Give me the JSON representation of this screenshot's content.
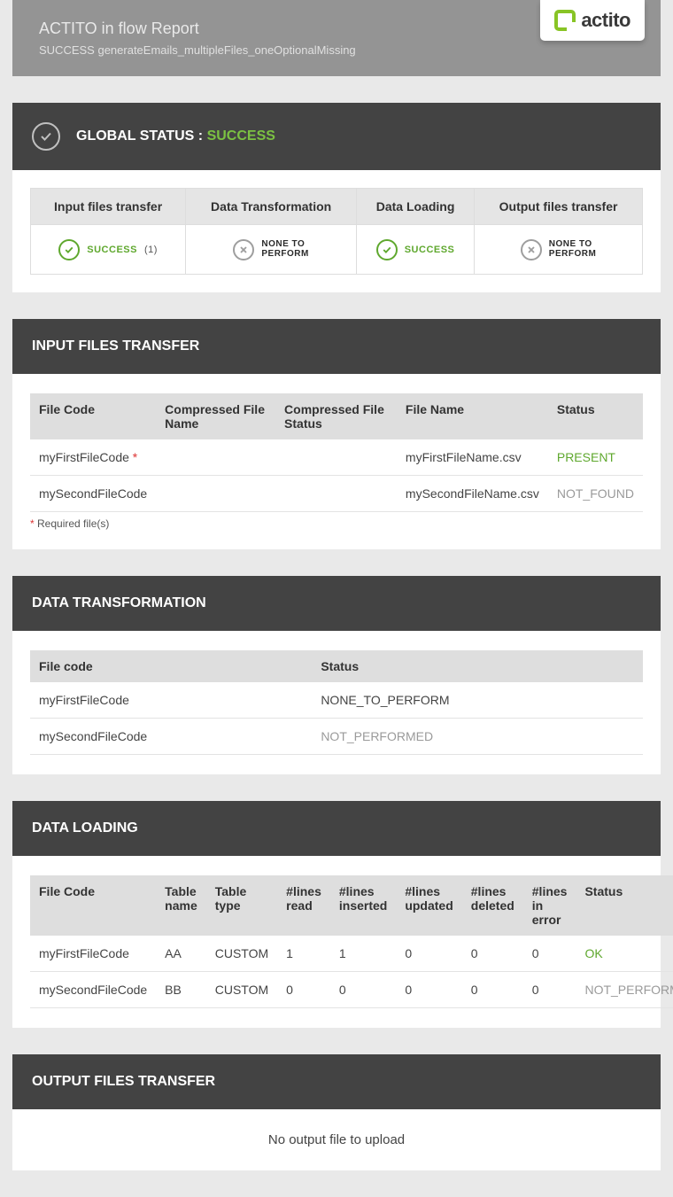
{
  "header": {
    "title": "ACTITO in flow Report",
    "subtitle": "SUCCESS generateEmails_multipleFiles_oneOptionalMissing",
    "logo_text": "actito"
  },
  "global_status": {
    "label": "GLOBAL STATUS :",
    "value": "SUCCESS"
  },
  "summary": {
    "headers": {
      "input": "Input files transfer",
      "transform": "Data Transformation",
      "loading": "Data Loading",
      "output": "Output files transfer"
    },
    "cells": {
      "input_status": "SUCCESS",
      "input_count": "(1)",
      "transform_status": "NONE TO\nPERFORM",
      "loading_status": "SUCCESS",
      "output_status": "NONE TO\nPERFORM"
    }
  },
  "input_files": {
    "section_title": "INPUT FILES TRANSFER",
    "headers": {
      "code": "File Code",
      "cfname": "Compressed File Name",
      "cfstatus": "Compressed File Status",
      "fname": "File Name",
      "status": "Status"
    },
    "rows": [
      {
        "code": "myFirstFileCode",
        "required": true,
        "cfname": "",
        "cfstatus": "",
        "fname": "myFirstFileName.csv",
        "status": "PRESENT",
        "status_ok": true
      },
      {
        "code": "mySecondFileCode",
        "required": false,
        "cfname": "",
        "cfstatus": "",
        "fname": "mySecondFileName.csv",
        "status": "NOT_FOUND",
        "status_ok": false
      }
    ],
    "footnote_star": "*",
    "footnote": "Required file(s)"
  },
  "data_transformation": {
    "section_title": "DATA TRANSFORMATION",
    "headers": {
      "code": "File code",
      "status": "Status"
    },
    "rows": [
      {
        "code": "myFirstFileCode",
        "status": "NONE_TO_PERFORM",
        "muted": false
      },
      {
        "code": "mySecondFileCode",
        "status": "NOT_PERFORMED",
        "muted": true
      }
    ]
  },
  "data_loading": {
    "section_title": "DATA LOADING",
    "headers": {
      "code": "File Code",
      "table": "Table name",
      "type": "Table type",
      "read": "#lines read",
      "inserted": "#lines inserted",
      "updated": "#lines updated",
      "deleted": "#lines deleted",
      "error": "#lines in error",
      "status": "Status"
    },
    "rows": [
      {
        "code": "myFirstFileCode",
        "table": "AA",
        "type": "CUSTOM",
        "read": "1",
        "inserted": "1",
        "updated": "0",
        "deleted": "0",
        "error": "0",
        "status": "OK",
        "ok": true
      },
      {
        "code": "mySecondFileCode",
        "table": "BB",
        "type": "CUSTOM",
        "read": "0",
        "inserted": "0",
        "updated": "0",
        "deleted": "0",
        "error": "0",
        "status": "NOT_PERFORMED",
        "ok": false
      }
    ]
  },
  "output_files": {
    "section_title": "OUTPUT FILES TRANSFER",
    "empty_message": "No output file to upload"
  }
}
